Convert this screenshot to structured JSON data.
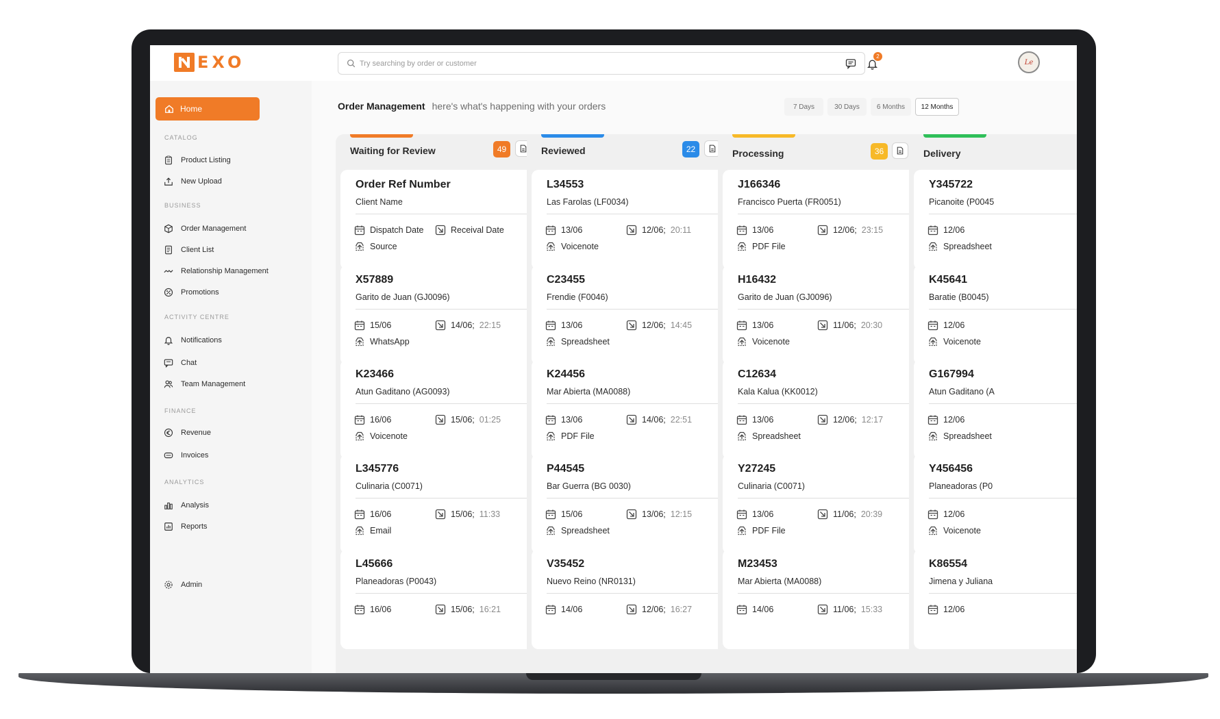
{
  "app": {
    "logo_text": "EXO",
    "brand_color": "#f07b27"
  },
  "search": {
    "placeholder": "Try searching by order or customer"
  },
  "notifications": {
    "count": "2"
  },
  "sidebar": {
    "home_label": "Home",
    "sections": [
      {
        "title": "CATALOG",
        "items": [
          {
            "label": "Product Listing",
            "icon": "clipboard-icon"
          },
          {
            "label": "New Upload",
            "icon": "upload-icon"
          }
        ]
      },
      {
        "title": "BUSINESS",
        "items": [
          {
            "label": "Order Management",
            "icon": "box-icon"
          },
          {
            "label": "Client List",
            "icon": "list-icon"
          },
          {
            "label": "Relationship Management",
            "icon": "handshake-icon"
          },
          {
            "label": "Promotions",
            "icon": "percent-icon"
          }
        ]
      },
      {
        "title": "ACTIVITY CENTRE",
        "items": [
          {
            "label": "Notifications",
            "icon": "bell-icon"
          },
          {
            "label": "Chat",
            "icon": "chat-icon"
          },
          {
            "label": "Team Management",
            "icon": "team-icon"
          }
        ]
      },
      {
        "title": "FINANCE",
        "items": [
          {
            "label": "Revenue",
            "icon": "euro-icon"
          },
          {
            "label": "Invoices",
            "icon": "invoice-icon"
          }
        ]
      },
      {
        "title": "ANALYTICS",
        "items": [
          {
            "label": "Analysis",
            "icon": "chart-icon"
          },
          {
            "label": "Reports",
            "icon": "report-icon"
          }
        ]
      }
    ],
    "admin_label": "Admin"
  },
  "page": {
    "title": "Order Management",
    "subtitle": "here's what's happening with your orders",
    "ranges": [
      "7 Days",
      "30 Days",
      "6 Months",
      "12 Months"
    ],
    "active_range": "12 Months"
  },
  "columns": [
    {
      "title": "Waiting for Review",
      "count": "49",
      "color": "#f07b27",
      "cards": [
        {
          "ref": "Order Ref Number",
          "client": "Client Name",
          "dispatch": "Dispatch Date",
          "receival": "Receival Date",
          "time": "",
          "source": "Source"
        },
        {
          "ref": "X57889",
          "client": "Garito de Juan (GJ0096)",
          "dispatch": "15/06",
          "receival": "14/06;",
          "time": "22:15",
          "source": "WhatsApp"
        },
        {
          "ref": "K23466",
          "client": "Atun Gaditano (AG0093)",
          "dispatch": "16/06",
          "receival": "15/06;",
          "time": "01:25",
          "source": "Voicenote"
        },
        {
          "ref": "L345776",
          "client": "Culinaria (C0071)",
          "dispatch": "16/06",
          "receival": "15/06;",
          "time": "11:33",
          "source": "Email"
        },
        {
          "ref": "L45666",
          "client": "Planeadoras (P0043)",
          "dispatch": "16/06",
          "receival": "15/06;",
          "time": "16:21",
          "source": ""
        }
      ]
    },
    {
      "title": "Reviewed",
      "count": "22",
      "color": "#2b8be8",
      "cards": [
        {
          "ref": "L34553",
          "client": "Las Farolas (LF0034)",
          "dispatch": "13/06",
          "receival": "12/06;",
          "time": "20:11",
          "source": "Voicenote"
        },
        {
          "ref": "C23455",
          "client": "Frendie (F0046)",
          "dispatch": "13/06",
          "receival": "12/06;",
          "time": "14:45",
          "source": "Spreadsheet"
        },
        {
          "ref": "K24456",
          "client": "Mar Abierta (MA0088)",
          "dispatch": "13/06",
          "receival": "14/06;",
          "time": "22:51",
          "source": "PDF File"
        },
        {
          "ref": "P44545",
          "client": "Bar Guerra (BG 0030)",
          "dispatch": "15/06",
          "receival": "13/06;",
          "time": "12:15",
          "source": "Spreadsheet"
        },
        {
          "ref": "V35452",
          "client": "Nuevo Reino (NR0131)",
          "dispatch": "14/06",
          "receival": "12/06;",
          "time": "16:27",
          "source": ""
        }
      ]
    },
    {
      "title": "Processing",
      "count": "36",
      "color": "#f7b928",
      "cards": [
        {
          "ref": "J166346",
          "client": "Francisco Puerta (FR0051)",
          "dispatch": "13/06",
          "receival": "12/06;",
          "time": "23:15",
          "source": "PDF File"
        },
        {
          "ref": "H16432",
          "client": "Garito de Juan (GJ0096)",
          "dispatch": "13/06",
          "receival": "11/06;",
          "time": "20:30",
          "source": "Voicenote"
        },
        {
          "ref": "C12634",
          "client": "Kala Kalua (KK0012)",
          "dispatch": "13/06",
          "receival": "12/06;",
          "time": "12:17",
          "source": "Spreadsheet"
        },
        {
          "ref": "Y27245",
          "client": "Culinaria (C0071)",
          "dispatch": "13/06",
          "receival": "11/06;",
          "time": "20:39",
          "source": "PDF File"
        },
        {
          "ref": "M23453",
          "client": "Mar Abierta (MA0088)",
          "dispatch": "14/06",
          "receival": "11/06;",
          "time": "15:33",
          "source": ""
        }
      ]
    },
    {
      "title": "Delivery",
      "count": "",
      "color": "#2fbf59",
      "cards": [
        {
          "ref": "Y345722",
          "client": "Picanoite (P0045",
          "dispatch": "12/06",
          "receival": "",
          "time": "",
          "source": "Spreadsheet"
        },
        {
          "ref": "K45641",
          "client": "Baratie (B0045)",
          "dispatch": "12/06",
          "receival": "",
          "time": "",
          "source": "Voicenote"
        },
        {
          "ref": "G167994",
          "client": "Atun Gaditano (A",
          "dispatch": "12/06",
          "receival": "",
          "time": "",
          "source": "Spreadsheet"
        },
        {
          "ref": "Y456456",
          "client": "Planeadoras (P0",
          "dispatch": "12/06",
          "receival": "",
          "time": "",
          "source": "Voicenote"
        },
        {
          "ref": "K86554",
          "client": "Jimena y Juliana",
          "dispatch": "12/06",
          "receival": "",
          "time": "",
          "source": ""
        }
      ]
    }
  ]
}
